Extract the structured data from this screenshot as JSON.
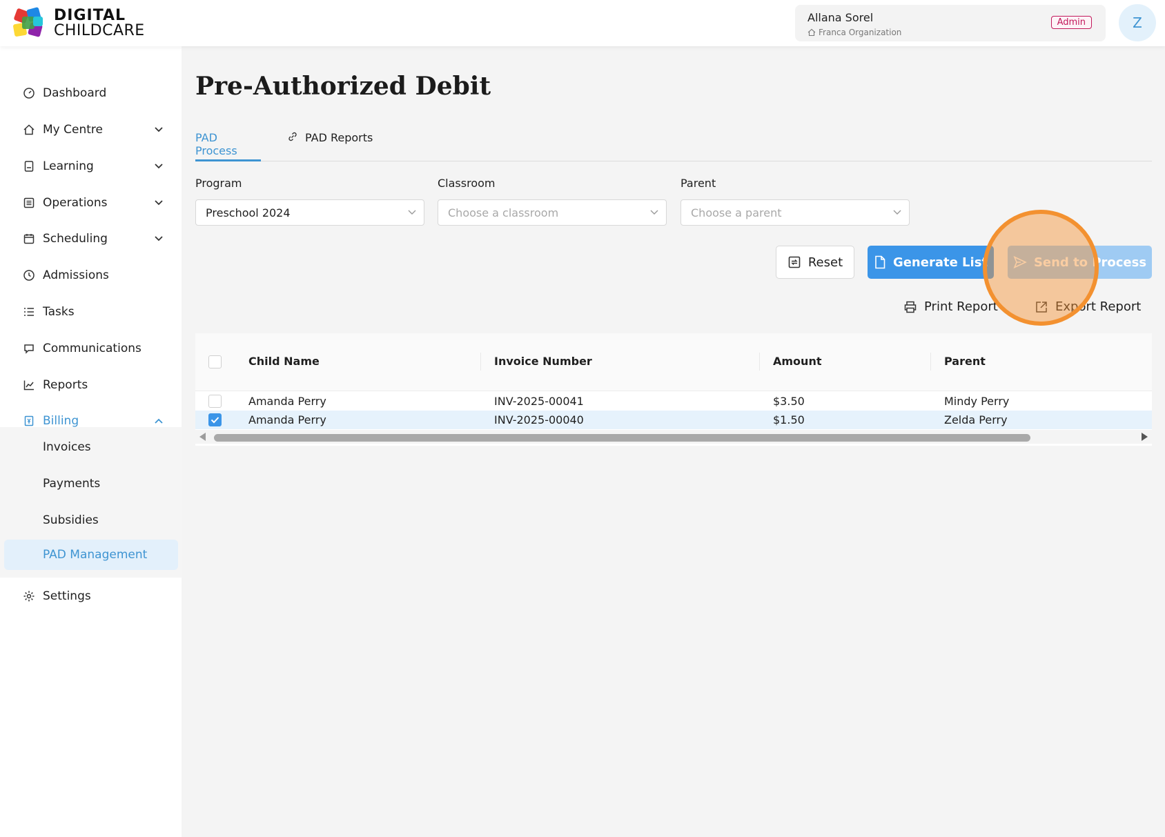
{
  "brand": {
    "line1": "DIGITAL",
    "line2": "CHILDCARE"
  },
  "user": {
    "name": "Allana Sorel",
    "organization": "Franca Organization",
    "role": "Admin",
    "avatar_letter": "Z"
  },
  "sidebar": {
    "items": [
      {
        "label": "Dashboard",
        "icon": "dashboard-icon"
      },
      {
        "label": "My Centre",
        "icon": "home-icon"
      },
      {
        "label": "Learning",
        "icon": "book-icon"
      },
      {
        "label": "Operations",
        "icon": "list-icon"
      },
      {
        "label": "Scheduling",
        "icon": "calendar-icon"
      },
      {
        "label": "Admissions",
        "icon": "clock-icon"
      },
      {
        "label": "Tasks",
        "icon": "checklist-icon"
      },
      {
        "label": "Communications",
        "icon": "chat-icon"
      },
      {
        "label": "Reports",
        "icon": "chart-icon"
      },
      {
        "label": "Billing",
        "icon": "billing-icon"
      }
    ],
    "billing_sub": [
      {
        "label": "Invoices"
      },
      {
        "label": "Payments"
      },
      {
        "label": "Subsidies"
      },
      {
        "label": "PAD Management"
      }
    ],
    "settings": {
      "label": "Settings",
      "icon": "gear-icon"
    }
  },
  "page": {
    "title": "Pre-Authorized Debit",
    "tabs": [
      {
        "label": "PAD Process"
      },
      {
        "label": "PAD Reports"
      }
    ]
  },
  "filters": {
    "program": {
      "label": "Program",
      "value": "Preschool 2024"
    },
    "classroom": {
      "label": "Classroom",
      "placeholder": "Choose a classroom"
    },
    "parent": {
      "label": "Parent",
      "placeholder": "Choose a parent"
    }
  },
  "actions": {
    "reset": "Reset",
    "generate": "Generate List",
    "send": "Send to Process",
    "print": "Print Report",
    "export": "Export Report"
  },
  "table": {
    "columns": [
      "Child Name",
      "Invoice Number",
      "Amount",
      "Parent"
    ],
    "rows": [
      {
        "child": "Amanda Perry",
        "invoice": "INV-2025-00041",
        "amount": "$3.50",
        "parent": "Mindy Perry",
        "checked": false
      },
      {
        "child": "Amanda Perry",
        "invoice": "INV-2025-00040",
        "amount": "$1.50",
        "parent": "Zelda Perry",
        "checked": true
      }
    ]
  },
  "colors": {
    "accent": "#3e94d2",
    "primary_button": "#3b95e8",
    "highlight": "#f39130"
  }
}
